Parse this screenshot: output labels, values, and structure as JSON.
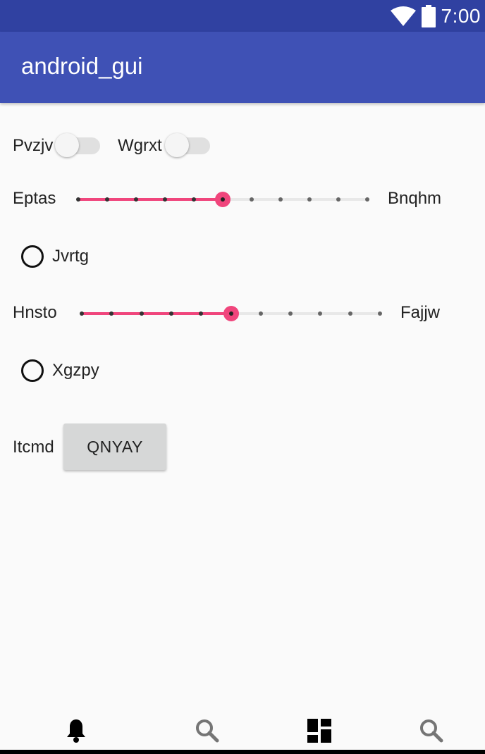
{
  "status_bar": {
    "time": "7:00",
    "icons": [
      "wifi-icon",
      "battery-icon"
    ]
  },
  "app_bar": {
    "title": "android_gui"
  },
  "switches": [
    {
      "label": "Pvzjv",
      "checked": false
    },
    {
      "label": "Wgrxt",
      "checked": false
    }
  ],
  "seekbars": [
    {
      "start_label": "Eptas",
      "end_label": "Bnqhm",
      "value": 5,
      "max": 10
    },
    {
      "start_label": "Hnsto",
      "end_label": "Fajjw",
      "value": 5,
      "max": 10
    }
  ],
  "radios": [
    {
      "label": "Jvrtg",
      "checked": false
    },
    {
      "label": "Xgzpy",
      "checked": false
    }
  ],
  "button_row": {
    "label": "Itcmd",
    "button_label": "QNYAY"
  },
  "bottom_nav": {
    "items": [
      "bell-icon",
      "search-icon",
      "dashboard-icon",
      "search-icon"
    ]
  },
  "colors": {
    "status_bar": "#3041a1",
    "app_bar": "#3f51b5",
    "accent": "#f0457c",
    "button": "#d6d7d7"
  }
}
